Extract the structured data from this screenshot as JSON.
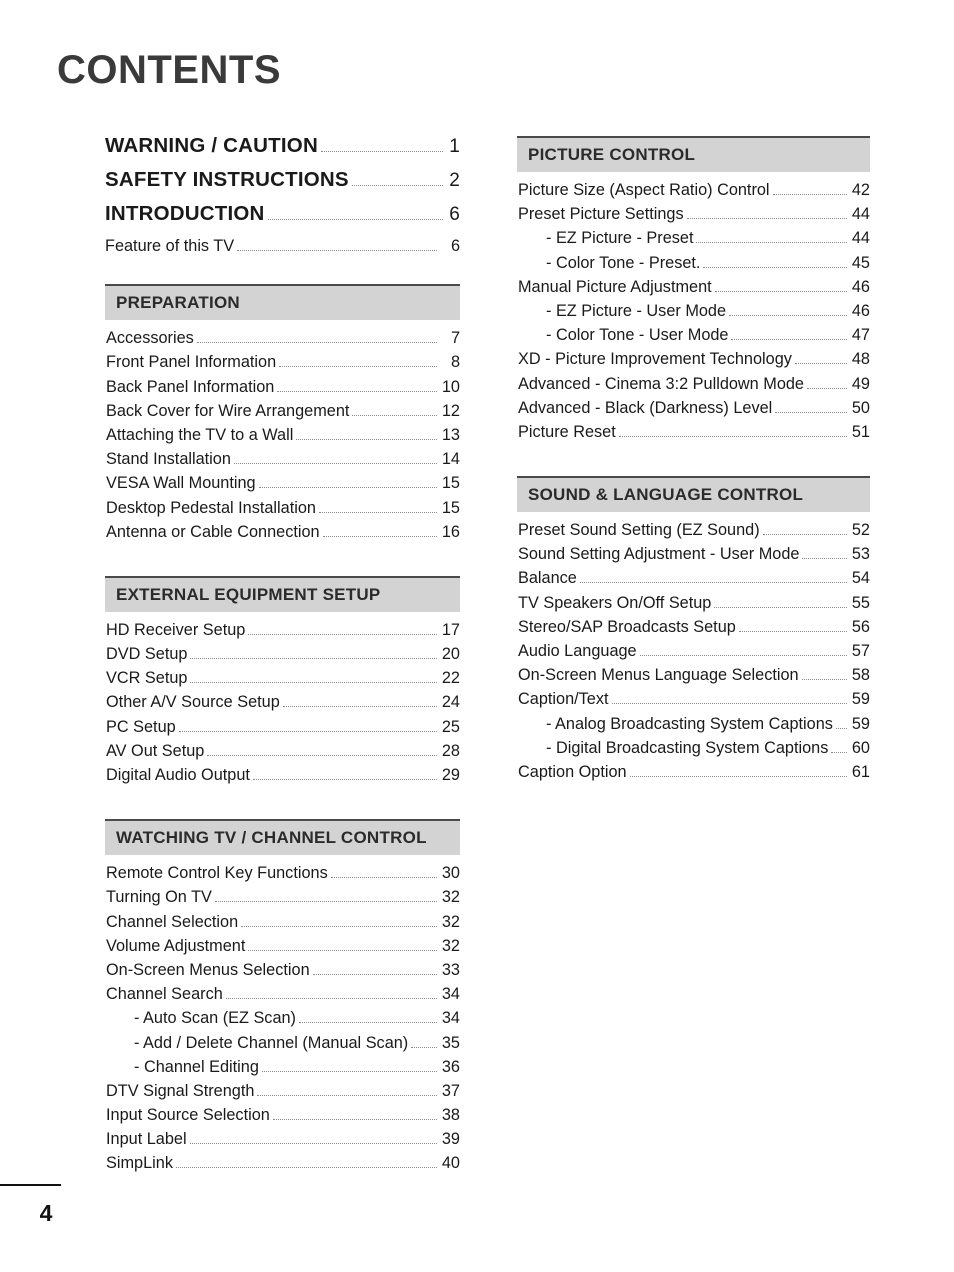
{
  "page": {
    "title": "CONTENTS",
    "page_number": "4"
  },
  "left_column": {
    "top_entries": [
      {
        "label": "WARNING / CAUTION",
        "page": "1"
      },
      {
        "label": "SAFETY INSTRUCTIONS",
        "page": "2"
      },
      {
        "label": "INTRODUCTION",
        "page": "6"
      }
    ],
    "top_sub_entries": [
      {
        "label": "Feature of this TV",
        "page": "6"
      }
    ],
    "sections": [
      {
        "title": "PREPARATION",
        "entries": [
          {
            "label": "Accessories",
            "page": "7",
            "indent": false
          },
          {
            "label": "Front Panel Information",
            "page": "8",
            "indent": false
          },
          {
            "label": "Back Panel Information",
            "page": "10",
            "indent": false
          },
          {
            "label": "Back Cover for Wire Arrangement",
            "page": "12",
            "indent": false
          },
          {
            "label": "Attaching the TV to a Wall",
            "page": "13",
            "indent": false
          },
          {
            "label": "Stand Installation",
            "page": "14",
            "indent": false
          },
          {
            "label": "VESA Wall Mounting",
            "page": "15",
            "indent": false
          },
          {
            "label": "Desktop Pedestal Installation",
            "page": "15",
            "indent": false
          },
          {
            "label": "Antenna or Cable Connection",
            "page": "16",
            "indent": false
          }
        ]
      },
      {
        "title": "EXTERNAL EQUIPMENT SETUP",
        "entries": [
          {
            "label": "HD Receiver Setup ",
            "page": "17",
            "indent": false
          },
          {
            "label": "DVD Setup",
            "page": "20",
            "indent": false
          },
          {
            "label": "VCR Setup",
            "page": "22",
            "indent": false
          },
          {
            "label": "Other A/V Source Setup",
            "page": "24",
            "indent": false
          },
          {
            "label": "PC Setup",
            "page": "25",
            "indent": false
          },
          {
            "label": "AV Out Setup",
            "page": "28",
            "indent": false
          },
          {
            "label": "Digital Audio Output",
            "page": "29",
            "indent": false
          }
        ]
      },
      {
        "title": "WATCHING TV / CHANNEL CONTROL",
        "entries": [
          {
            "label": "Remote Control Key Functions",
            "page": "30",
            "indent": false
          },
          {
            "label": "Turning On TV",
            "page": "32",
            "indent": false
          },
          {
            "label": "Channel Selection",
            "page": "32",
            "indent": false
          },
          {
            "label": "Volume Adjustment",
            "page": "32",
            "indent": false
          },
          {
            "label": "On-Screen Menus Selection",
            "page": "33",
            "indent": false
          },
          {
            "label": "Channel Search",
            "page": "34",
            "indent": false
          },
          {
            "label": "- Auto Scan (EZ Scan)",
            "page": "34",
            "indent": true
          },
          {
            "label": "- Add / Delete Channel (Manual Scan)",
            "page": "35",
            "indent": true
          },
          {
            "label": "- Channel Editing",
            "page": "36",
            "indent": true
          },
          {
            "label": "DTV Signal Strength",
            "page": "37",
            "indent": false
          },
          {
            "label": "Input Source Selection",
            "page": "38",
            "indent": false
          },
          {
            "label": "Input Label",
            "page": "39",
            "indent": false
          },
          {
            "label": "SimpLink",
            "page": "40",
            "indent": false
          }
        ]
      }
    ]
  },
  "right_column": {
    "sections": [
      {
        "title": "PICTURE CONTROL",
        "entries": [
          {
            "label": "Picture Size (Aspect Ratio) Control",
            "page": "42",
            "indent": false
          },
          {
            "label": "Preset Picture Settings",
            "page": "44",
            "indent": false
          },
          {
            "label": "- EZ Picture - Preset",
            "page": "44",
            "indent": true
          },
          {
            "label": "- Color Tone - Preset.",
            "page": "45",
            "indent": true
          },
          {
            "label": "Manual Picture Adjustment",
            "page": "46",
            "indent": false
          },
          {
            "label": "- EZ Picture - User Mode",
            "page": "46",
            "indent": true
          },
          {
            "label": "- Color Tone - User Mode",
            "page": "47",
            "indent": true
          },
          {
            "label": "XD - Picture Improvement Technology",
            "page": "48",
            "indent": false
          },
          {
            "label": "Advanced - Cinema 3:2 Pulldown Mode",
            "page": "49",
            "indent": false
          },
          {
            "label": "Advanced - Black (Darkness) Level",
            "page": "50",
            "indent": false
          },
          {
            "label": "Picture Reset ",
            "page": "51",
            "indent": false
          }
        ]
      },
      {
        "title": "SOUND & LANGUAGE CONTROL",
        "entries": [
          {
            "label": "Preset Sound Setting (EZ Sound)",
            "page": "52",
            "indent": false
          },
          {
            "label": "Sound Setting Adjustment - User Mode",
            "page": "53",
            "indent": false
          },
          {
            "label": "Balance",
            "page": "54",
            "indent": false
          },
          {
            "label": "TV Speakers On/Off Setup",
            "page": "55",
            "indent": false
          },
          {
            "label": "Stereo/SAP Broadcasts Setup",
            "page": "56",
            "indent": false
          },
          {
            "label": "Audio Language",
            "page": "57",
            "indent": false
          },
          {
            "label": "On-Screen Menus Language Selection",
            "page": "58",
            "indent": false
          },
          {
            "label": "Caption/Text",
            "page": "59",
            "indent": false
          },
          {
            "label": "- Analog Broadcasting System Captions",
            "page": "59",
            "indent": true
          },
          {
            "label": "- Digital Broadcasting System Captions",
            "page": "60",
            "indent": true
          },
          {
            "label": "Caption Option ",
            "page": "61",
            "indent": false
          }
        ]
      }
    ]
  },
  "colors": {
    "section_header_bg": "#d3d3d3",
    "section_header_rule": "#4a4a4a",
    "title": "#3a3a3a",
    "text": "#1a1a1a",
    "leader_dots": "#8a8a8a"
  }
}
